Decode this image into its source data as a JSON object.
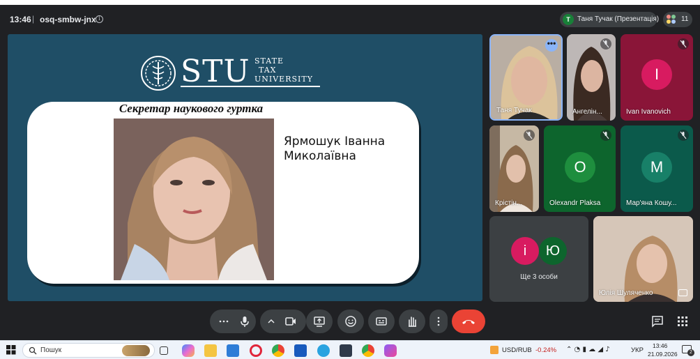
{
  "topbar": {
    "time": "13:46",
    "separator": "|",
    "meeting_code": "osq-smbw-jnx",
    "info_icon": "info-icon",
    "presenter_initial": "T",
    "presenter_label": "Таня Тучак (Презентація)",
    "participants_count": "11"
  },
  "slide": {
    "logo_text": "STU",
    "logo_words": [
      "STATE",
      "TAX",
      "UNIVERSITY"
    ],
    "card_title": "Секретар наукового гуртка",
    "person_name_line1": "Ярмошук Іванна",
    "person_name_line2": "Миколаївна"
  },
  "participants": [
    {
      "name": "Таня Тучак",
      "type": "video",
      "active": true
    },
    {
      "name": "Ангелін...",
      "type": "video",
      "muted": true
    },
    {
      "name": "Ivan Ivanovich",
      "type": "avatar",
      "initial": "I",
      "color": "#d81b60",
      "tile_color": "#8a1538",
      "muted": true
    },
    {
      "name": "Крістін...",
      "type": "video",
      "muted": true
    },
    {
      "name": "Olexandr Plaksa",
      "type": "avatar",
      "initial": "O",
      "color": "#1e8e3e",
      "tile_color": "#0d652d",
      "muted": true
    },
    {
      "name": "Мар'яна Кошу...",
      "type": "avatar",
      "initial": "M",
      "color": "#188068",
      "tile_color": "#0b5a4b",
      "muted": true
    },
    {
      "name": "Юлія Шуляченко",
      "type": "video"
    }
  ],
  "group_tile": {
    "initials": [
      "і",
      "Ю"
    ],
    "colors": [
      "#d81b60",
      "#0d652d"
    ],
    "label": "Ще 3 особи"
  },
  "controls": {
    "more_icon": "more-horiz-icon",
    "mic_icon": "microphone-icon",
    "chevron_icon": "chevron-up-icon",
    "camera_icon": "camera-icon",
    "present_icon": "present-screen-icon",
    "emoji_icon": "emoji-icon",
    "captions_icon": "captions-icon",
    "hand_icon": "raise-hand-icon",
    "options_icon": "more-vert-icon",
    "end_icon": "end-call-icon",
    "chat_icon": "chat-icon",
    "activities_icon": "apps-grid-icon",
    "end_color": "#ea4335"
  },
  "taskbar": {
    "search_placeholder": "Пошук",
    "ticker": "USD/RUB",
    "ticker_change": "-0.24%",
    "ticker_change_color": "#c5221f",
    "language": "УКР",
    "clock_time": "13:46",
    "clock_date": "21.09.2026",
    "notification_count": "2"
  }
}
